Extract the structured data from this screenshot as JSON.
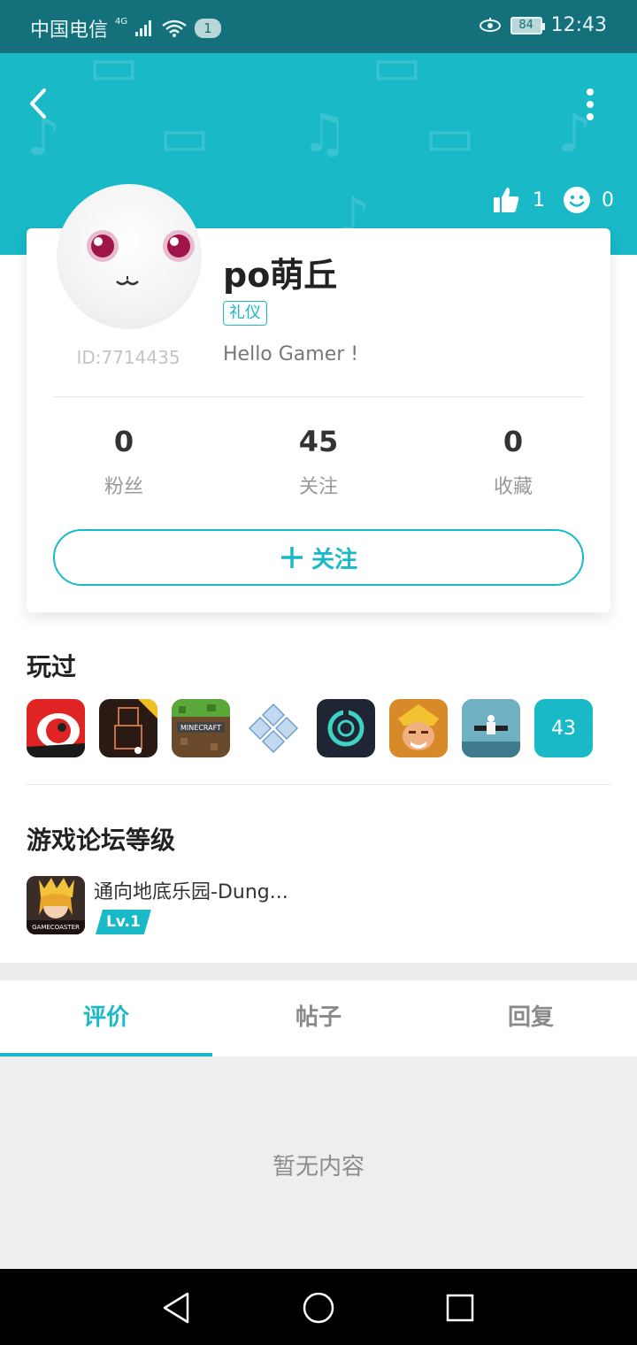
{
  "status_bar": {
    "carrier": "中国电信",
    "network": "4G",
    "notification_count": "1",
    "battery": "84",
    "time": "12:43"
  },
  "header": {
    "likes": "1",
    "smiles": "0"
  },
  "profile": {
    "username": "po萌丘",
    "tag": "礼仪",
    "user_id": "ID:7714435",
    "bio": "Hello Gamer !",
    "stats": [
      {
        "value": "0",
        "label": "粉丝"
      },
      {
        "value": "45",
        "label": "关注"
      },
      {
        "value": "0",
        "label": "收藏"
      }
    ],
    "follow_button": "关注"
  },
  "played": {
    "title": "玩过",
    "games": [
      {
        "icon": "red-blob-game-icon",
        "color": "#e02424"
      },
      {
        "icon": "dark-character-game-icon",
        "color": "#2a1a14"
      },
      {
        "icon": "minecraft-game-icon",
        "color": "#6b4a2b"
      },
      {
        "icon": "ppsspp-game-icon",
        "color": "#ffffff"
      },
      {
        "icon": "teal-ring-game-icon",
        "color": "#1f2533"
      },
      {
        "icon": "clash-of-clans-game-icon",
        "color": "#d88a2a"
      },
      {
        "icon": "plane-game-icon",
        "color": "#4f8fa3"
      }
    ],
    "more_count": "43"
  },
  "forum_level": {
    "title": "游戏论坛等级",
    "game_name": "通向地底乐园-Dung...",
    "level": "Lv.1",
    "icon_text": "GAMECOASTER"
  },
  "tabs": [
    {
      "label": "评价",
      "active": true
    },
    {
      "label": "帖子",
      "active": false
    },
    {
      "label": "回复",
      "active": false
    }
  ],
  "empty_state": "暂无内容",
  "colors": {
    "accent": "#19b9c8",
    "status_bar": "#14707a"
  }
}
